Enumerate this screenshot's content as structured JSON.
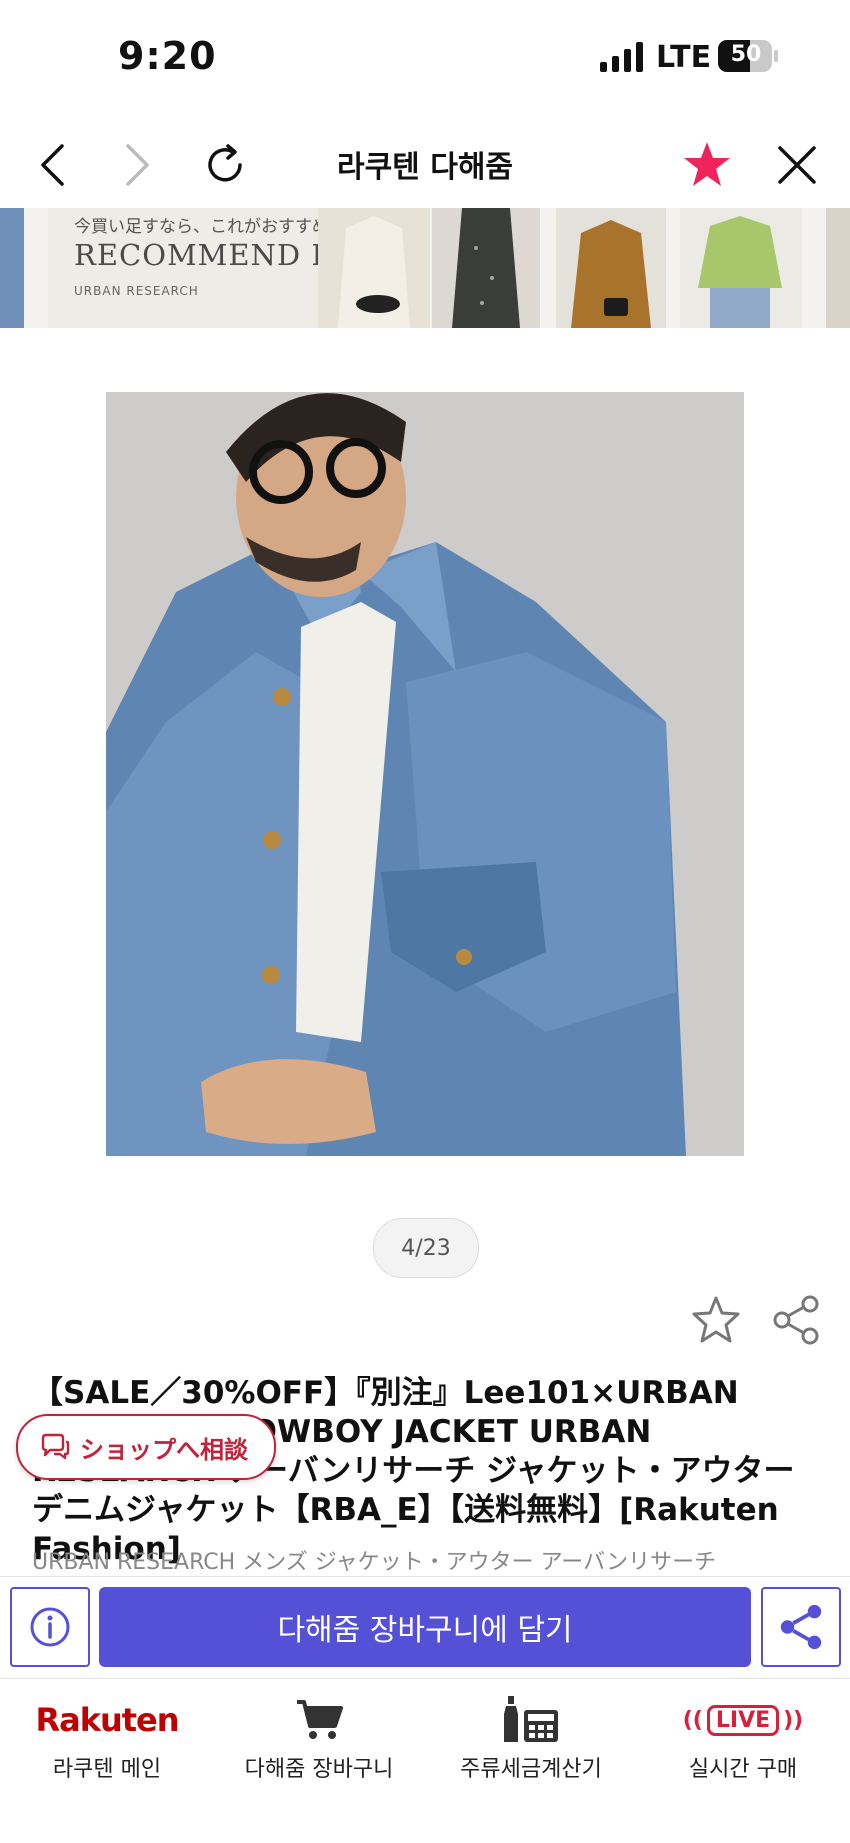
{
  "status": {
    "time": "9:20",
    "network": "LTE",
    "battery": "50"
  },
  "nav": {
    "title": "라쿠텐 다해줌"
  },
  "banner": {
    "subtitle": "今買い足すなら、これがおすすめ！",
    "heading": "RECOMMEND ITEM",
    "brand": "URBAN RESEARCH"
  },
  "gallery": {
    "counter": "4/23"
  },
  "product": {
    "title": "【SALE／30%OFF】『別注』Lee101×URBAN RESEARCH COWBOY JACKET URBAN RESEARCH アーバンリサーチ ジャケット・アウター デニムジャケット【RBA_E】【送料無料】[Rakuten Fashion]",
    "subline": "URBAN RESEARCH メンズ ジャケット・アウター アーバンリサーチ"
  },
  "consult_button": {
    "label": "ショップへ相談"
  },
  "actions": {
    "add_to_cart": "다해줌 장바구니에 담기"
  },
  "tabs": [
    {
      "label": "라쿠텐 메인",
      "logo": "Rakuten"
    },
    {
      "label": "다해줌 장바구니"
    },
    {
      "label": "주류세금계산기"
    },
    {
      "label": "실시간 구매",
      "badge": "LIVE"
    }
  ],
  "colors": {
    "accent": "#5551d6",
    "rakuten_red": "#bf0000",
    "favorite": "#f0245a",
    "consult": "#c0243b"
  }
}
